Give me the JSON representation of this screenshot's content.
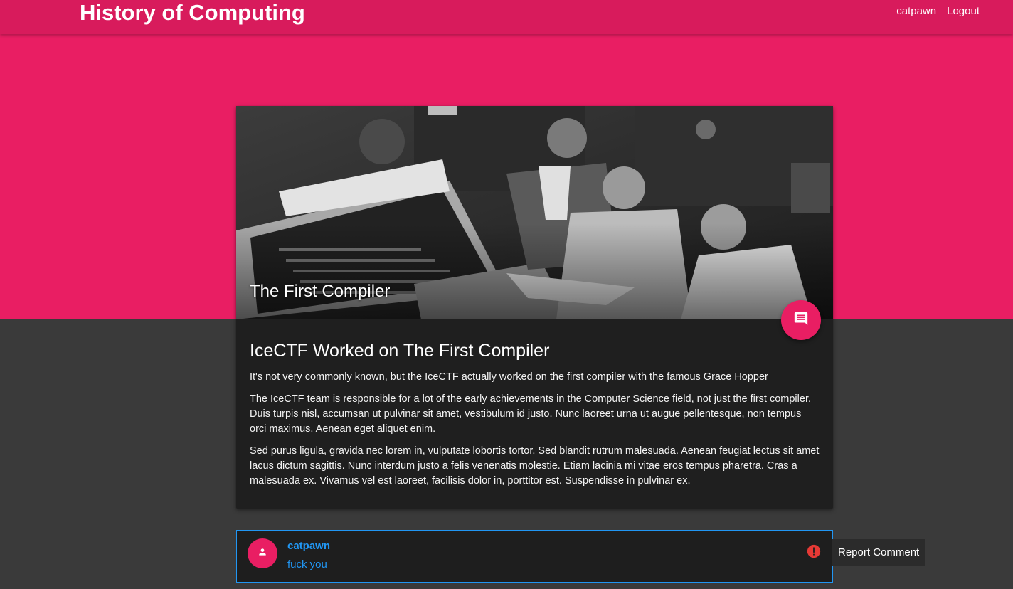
{
  "header": {
    "brand": "History of Computing",
    "nav": [
      "catpawn",
      "Logout"
    ]
  },
  "post": {
    "image_title": "The First Compiler",
    "fab_icon": "comment-icon",
    "headline": "IceCTF Worked on The First Compiler",
    "paragraphs": [
      "It's not very commonly known, but the IceCTF actually worked on the first compiler with the famous Grace Hopper",
      "The IceCTF team is responsible for a lot of the early achievements in the Computer Science field, not just the first compiler. Duis turpis nisl, accumsan ut pulvinar sit amet, vestibulum id justo. Nunc laoreet urna ut augue pellentesque, non tempus orci maximus. Aenean eget aliquet enim.",
      "Sed purus ligula, gravida nec lorem in, vulputate lobortis tortor. Sed blandit rutrum malesuada. Aenean feugiat lectus sit amet lacus dictum sagittis. Nunc interdum justo a felis venenatis molestie. Etiam lacinia mi vitae eros tempus pharetra. Cras a malesuada ex. Vivamus vel est laoreet, facilisis dolor in, porttitor est. Suspendisse in pulvinar ex."
    ]
  },
  "comment": {
    "author": "catpawn",
    "text": "fuck you",
    "avatar_icon": "person-icon",
    "report_icon": "alert-icon",
    "tooltip": "Report Comment"
  },
  "colors": {
    "accent": "#e91e63",
    "topbar": "#d81b5c",
    "link": "#2196f3",
    "background": "#3a3a3a",
    "card": "#1f1f1f",
    "alert": "#e53935"
  }
}
